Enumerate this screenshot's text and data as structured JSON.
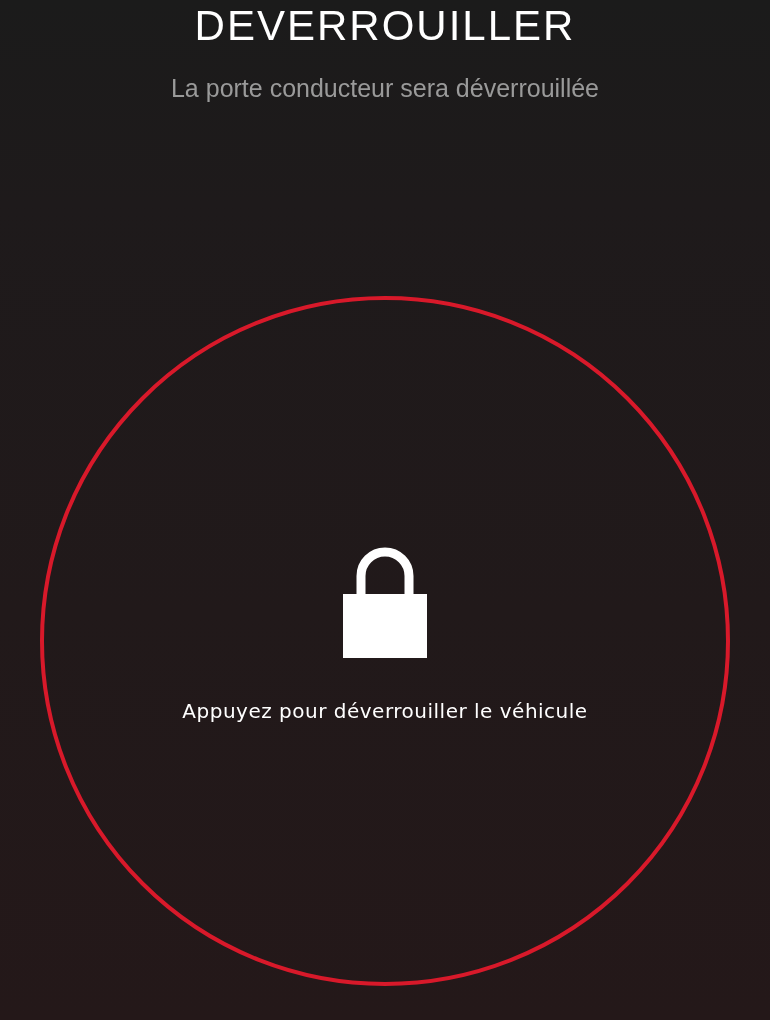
{
  "header": {
    "title": "DEVERROUILLER",
    "subtitle": "La porte conducteur sera déverrouillée"
  },
  "unlock_button": {
    "locked": true,
    "label": "Appuyez pour déverrouiller le véhicule"
  }
}
